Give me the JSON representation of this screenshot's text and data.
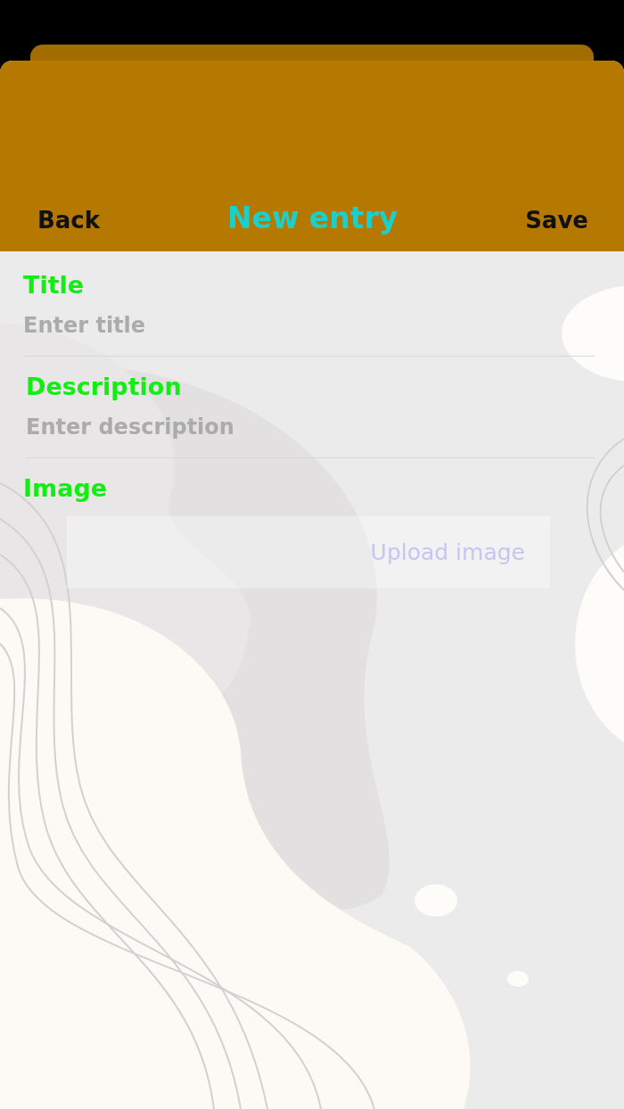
{
  "nav": {
    "back": "Back",
    "title": "New entry",
    "save": "Save"
  },
  "fields": [
    {
      "label": "Title",
      "placeholder": "Enter title"
    },
    {
      "label": "Description",
      "placeholder": "Enter description"
    }
  ],
  "image": {
    "label": "Image",
    "button": "Upload image"
  }
}
